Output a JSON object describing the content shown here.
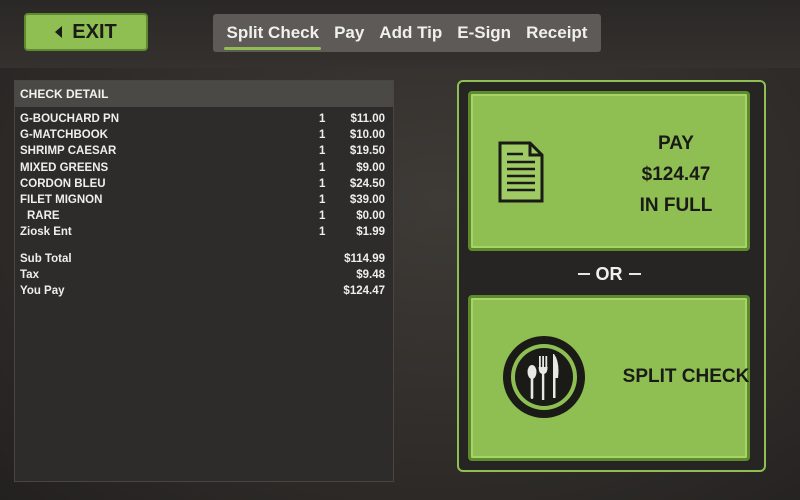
{
  "header": {
    "exit_label": "EXIT",
    "tabs": [
      {
        "label": "Split Check",
        "active": true
      },
      {
        "label": "Pay",
        "active": false
      },
      {
        "label": "Add Tip",
        "active": false
      },
      {
        "label": "E-Sign",
        "active": false
      },
      {
        "label": "Receipt",
        "active": false
      }
    ]
  },
  "check": {
    "title": "CHECK DETAIL",
    "items": [
      {
        "name": "G-BOUCHARD PN",
        "qty": "1",
        "price": "$11.00"
      },
      {
        "name": "G-MATCHBOOK",
        "qty": "1",
        "price": "$10.00"
      },
      {
        "name": "SHRIMP CAESAR",
        "qty": "1",
        "price": "$19.50"
      },
      {
        "name": "MIXED GREENS",
        "qty": "1",
        "price": "$9.00"
      },
      {
        "name": "CORDON BLEU",
        "qty": "1",
        "price": "$24.50"
      },
      {
        "name": "FILET MIGNON",
        "qty": "1",
        "price": "$39.00"
      },
      {
        "name": "RARE",
        "qty": "1",
        "price": "$0.00"
      },
      {
        "name": "Ziosk Ent",
        "qty": "1",
        "price": "$1.99"
      }
    ],
    "totals": [
      {
        "label": "Sub Total",
        "value": "$114.99"
      },
      {
        "label": "Tax",
        "value": "$9.48"
      },
      {
        "label": "You Pay",
        "value": "$124.47"
      }
    ]
  },
  "options": {
    "pay_line1": "PAY",
    "pay_line2": "$124.47",
    "pay_line3": "IN FULL",
    "or_label": "OR",
    "split_label": "SPLIT CHECK",
    "icons": [
      "document-icon",
      "plate-utensils-icon"
    ]
  },
  "colors": {
    "accent": "#8fbf52",
    "accent_border": "#5d8a2b",
    "panel": "#2e2c2a",
    "tab_bar": "#5d5a57"
  }
}
